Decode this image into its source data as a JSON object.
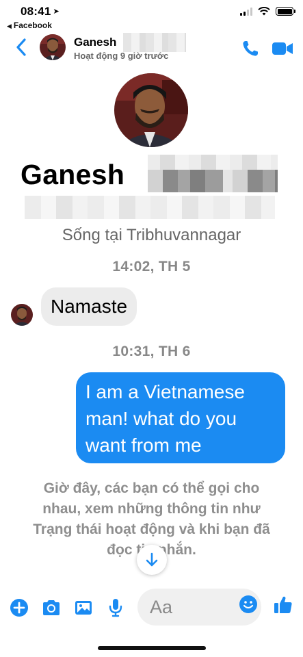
{
  "status_bar": {
    "time": "08:41",
    "back_app": "Facebook"
  },
  "header": {
    "contact_name": "Ganesh",
    "activity": "Hoạt động 9 giờ trước"
  },
  "profile": {
    "name": "Ganesh",
    "location": "Sống tại Tribhuvannagar"
  },
  "conversation": {
    "timestamp_1": "14:02, TH 5",
    "incoming_message": "Namaste",
    "timestamp_2": "10:31, TH 6",
    "outgoing_line_1": "I am a Vietnamese",
    "outgoing_line_2": "man!  what do you",
    "outgoing_line_3": "want from me",
    "notice_line_1": "Giờ đây, các bạn có thể gọi cho",
    "notice_line_2": "nhau, xem những thông tin như",
    "notice_line_3": "Trạng thái hoạt động và khi bạn đã",
    "notice_line_4": "đọc tin nhắn."
  },
  "composer": {
    "placeholder": "Aa"
  },
  "icons": {
    "back": "chevron-left-icon",
    "call": "phone-icon",
    "video": "video-camera-icon",
    "plus": "plus-icon",
    "camera": "camera-icon",
    "gallery": "image-icon",
    "mic": "microphone-icon",
    "emoji": "emoji-icon",
    "like": "thumbs-up-icon",
    "scroll": "arrow-down-icon"
  },
  "colors": {
    "accent": "#1b8bf2",
    "incoming_bubble": "#ececec",
    "muted_text": "#888888"
  }
}
